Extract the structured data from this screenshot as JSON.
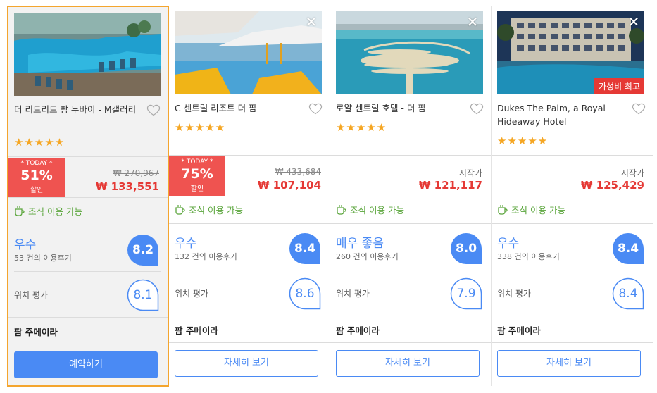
{
  "hotels": [
    {
      "name": "더 리트리트 팜 두바이 - M갤러리",
      "stars": "★★★★★",
      "today_label": "* TODAY *",
      "discount": "51%",
      "discount_suffix": "할인",
      "price_original": "₩ 270,967",
      "price": "₩ 133,551",
      "breakfast": "조식 이용 가능",
      "rating_word": "우수",
      "reviews": "53 건의 이용후기",
      "score": "8.2",
      "location_label": "위치 평가",
      "location_score": "8.1",
      "area": "팜 주메이라",
      "button": "예약하기"
    },
    {
      "name": "C 센트럴 리조트 더 팜",
      "stars": "★★★★★",
      "today_label": "* TODAY *",
      "discount": "75%",
      "discount_suffix": "할인",
      "price_original": "₩ 433,684",
      "price": "₩ 107,104",
      "breakfast": "조식 이용 가능",
      "rating_word": "우수",
      "reviews": "132 건의 이용후기",
      "score": "8.4",
      "location_label": "위치 평가",
      "location_score": "8.6",
      "area": "팜 주메이라",
      "button": "자세히 보기",
      "close": "✕"
    },
    {
      "name": "로얄 센트럴 호텔 - 더 팜",
      "stars": "★★★★★",
      "price_from": "시작가",
      "price": "₩ 121,117",
      "breakfast": "조식 이용 가능",
      "rating_word": "매우 좋음",
      "reviews": "260 건의 이용후기",
      "score": "8.0",
      "location_label": "위치 평가",
      "location_score": "7.9",
      "area": "팜 주메이라",
      "button": "자세히 보기",
      "close": "✕"
    },
    {
      "name": "Dukes The Palm, a Royal Hideaway Hotel",
      "stars": "★★★★★",
      "price_from": "시작가",
      "price": "₩ 125,429",
      "breakfast": "조식 이용 가능",
      "rating_word": "우수",
      "reviews": "338 건의 이용후기",
      "score": "8.4",
      "location_label": "위치 평가",
      "location_score": "8.4",
      "area": "팜 주메이라",
      "button": "자세히 보기",
      "close": "✕",
      "value_badge": "가성비 최고"
    }
  ],
  "colors": {
    "accent": "#4a8af4",
    "price": "#e53935",
    "today_bg": "#ef5350",
    "stars": "#f5a623",
    "breakfast": "#5aa53b",
    "highlight_border": "#f4a52e"
  },
  "icons": [
    "heart-icon",
    "close-icon",
    "coffee-cup-icon",
    "star-icon"
  ]
}
